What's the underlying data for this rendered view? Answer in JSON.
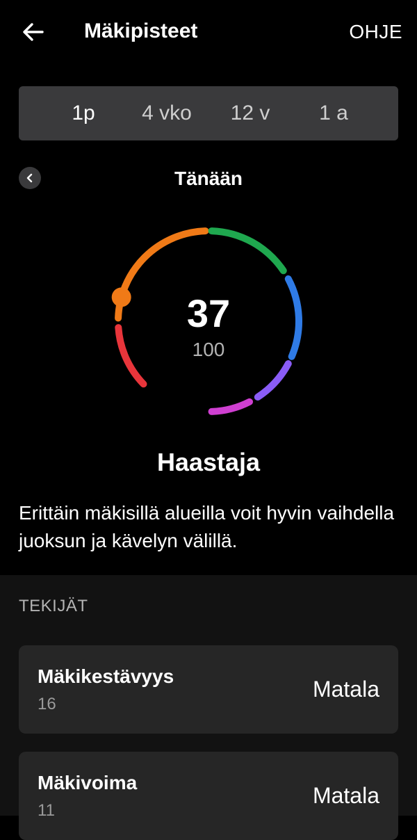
{
  "header": {
    "title": "Mäkipisteet",
    "help_label": "OHJE",
    "back_icon": "arrow-left-icon"
  },
  "period_tabs": [
    {
      "label": "1p",
      "selected": true
    },
    {
      "label": "4 vko",
      "selected": false
    },
    {
      "label": "12 v",
      "selected": false
    },
    {
      "label": "1 a",
      "selected": false
    }
  ],
  "date_nav": {
    "label": "Tänään",
    "prev_icon": "chevron-left-icon"
  },
  "gauge": {
    "score": "37",
    "max": "100",
    "score_value": 37,
    "max_value": 100,
    "segment_colors": [
      "#e8353b",
      "#f07a17",
      "#1fa84f",
      "#2f7be6",
      "#8a5cf6",
      "#cf3fd1"
    ]
  },
  "level": {
    "title": "Haastaja",
    "description": "Erittäin mäkisillä alueilla voit hyvin vaihdella juoksun ja kävelyn välillä."
  },
  "factors": {
    "header": "TEKIJÄT",
    "items": [
      {
        "name": "Mäkikestävyys",
        "value": "16",
        "rating": "Matala"
      },
      {
        "name": "Mäkivoima",
        "value": "11",
        "rating": "Matala"
      }
    ]
  }
}
